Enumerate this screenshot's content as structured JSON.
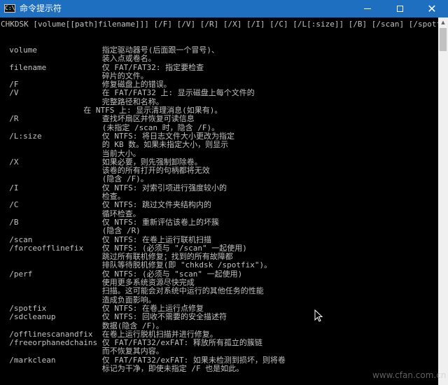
{
  "window": {
    "title": "命令提示符",
    "icon_text": "C:\\",
    "controls": [
      "minimize-icon",
      "maximize-icon",
      "close-icon"
    ],
    "close_glyph": "✕"
  },
  "console": {
    "lines": [
      "CHKDSK [volume[[path]filename]]] [/F] [/V] [/R] [/X] [/I] [/C] [/L[:size]] [/B] [/scan] [/spotfix]",
      "",
      "",
      "  volume              指定驱动器号(后面跟一个冒号)、",
      "                      装入点或卷名。",
      "  filename            仅 FAT/FAT32: 指定要检查",
      "                      碎片的文件。",
      "  /F                  修复磁盘上的错误。",
      "  /V                  在 FAT/FAT32 上: 显示磁盘上每个文件的",
      "                      完整路径和名称。",
      "                  在 NTFS 上: 显示清理消息(如果有)。",
      "  /R                  查找坏扇区并恢复可读信息",
      "                      (未指定 /scan 时，隐含 /F)。",
      "  /L:size             仅 NTFS: 将日志文件大小更改为指定",
      "                      的 KB 数。如果未指定大小，则显示",
      "                      当前大小。",
      "  /X                  如果必要，则先强制卸除卷。",
      "                      该卷的所有打开的句柄都将无效",
      "                      (隐含 /F)。",
      "  /I                  仅 NTFS: 对索引项进行强度较小的",
      "                      检查。",
      "  /C                  仅 NTFS: 跳过文件夹结构内的",
      "                      循环检查。",
      "  /B                  仅 NTFS: 重新评估该卷上的坏簇",
      "                      (隐含 /R)",
      "  /scan               仅 NTFS: 在卷上运行联机扫描",
      "  /forceofflinefix    仅 NTFS: (必须与 \"/scan\" 一起使用)",
      "                      跳过所有联机修复；找到的所有故障都",
      "                      排队等待脱机修复(即 \"chkdsk /spotfix\")。",
      "  /perf               仅 NTFS: (必须与 \"scan\" 一起使用)",
      "                      使用更多系统资源尽快完成",
      "                      扫描。这可能会对系统中运行的其他任务的性能",
      "                      造成负面影响。",
      "  /spotfix            仅 NTFS: 在卷上运行点修复",
      "  /sdcleanup          仅 NTFS: 回收不需要的安全描述符",
      "                      数据(隐含 /F)。",
      "  /offlinescanandfix  在卷上运行脱机扫描并进行修复。",
      "  /freeorphanedchains 仅 FAT/FAT32/exFAT: 释放所有孤立的簇链",
      "                      而不恢复其内容。",
      "  /markclean          仅 FAT/FAT32/exFAT: 如果未检测到损坏，则将卷",
      "                      标记为干净，即使未指定 /F 也是如此。"
    ]
  },
  "scrollbar": {
    "up_glyph": "▲"
  },
  "watermark": "www.cfan.com.cn",
  "colors": {
    "titlebar": "#1e6fc0",
    "console_bg": "#000000",
    "console_text": "#c0c0c0",
    "scrollbar_bg": "#f0f0f0"
  }
}
